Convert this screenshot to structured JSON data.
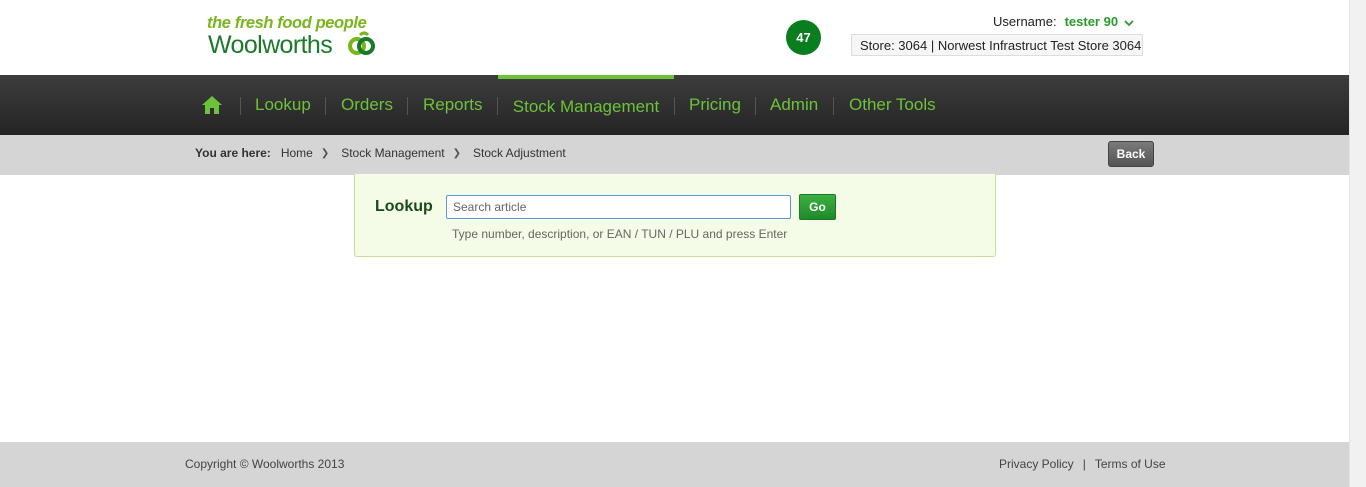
{
  "header": {
    "tagline": "the fresh food people",
    "brand": "Woolworths",
    "badge_count": "47",
    "username_label": "Username:",
    "username_value": "tester 90",
    "store": "Store: 3064 | Norwest Infrastruct Test Store 3064"
  },
  "nav": {
    "items": [
      {
        "label": "Lookup"
      },
      {
        "label": "Orders"
      },
      {
        "label": "Reports"
      },
      {
        "label": "Stock Management"
      },
      {
        "label": "Pricing"
      },
      {
        "label": "Admin"
      },
      {
        "label": "Other Tools"
      }
    ],
    "active": "Stock Management"
  },
  "breadcrumb": {
    "prefix": "You are here:",
    "items": [
      "Home",
      "Stock Management",
      "Stock Adjustment"
    ],
    "back_label": "Back"
  },
  "lookup": {
    "label": "Lookup",
    "placeholder": "Search article",
    "go_label": "Go",
    "hint": "Type number, description, or EAN / TUN / PLU and press Enter"
  },
  "footer": {
    "copyright": "Copyright © Woolworths 2013",
    "privacy": "Privacy Policy",
    "separator": "|",
    "terms": "Terms of Use"
  },
  "colors": {
    "brand_green": "#1a7a2a",
    "nav_green": "#6cc23a",
    "badge_green": "#0a7d1e",
    "nav_bg": "#2e2e2e",
    "crumb_bg": "#d5d5d5",
    "panel_bg": "#f4fbe6"
  }
}
